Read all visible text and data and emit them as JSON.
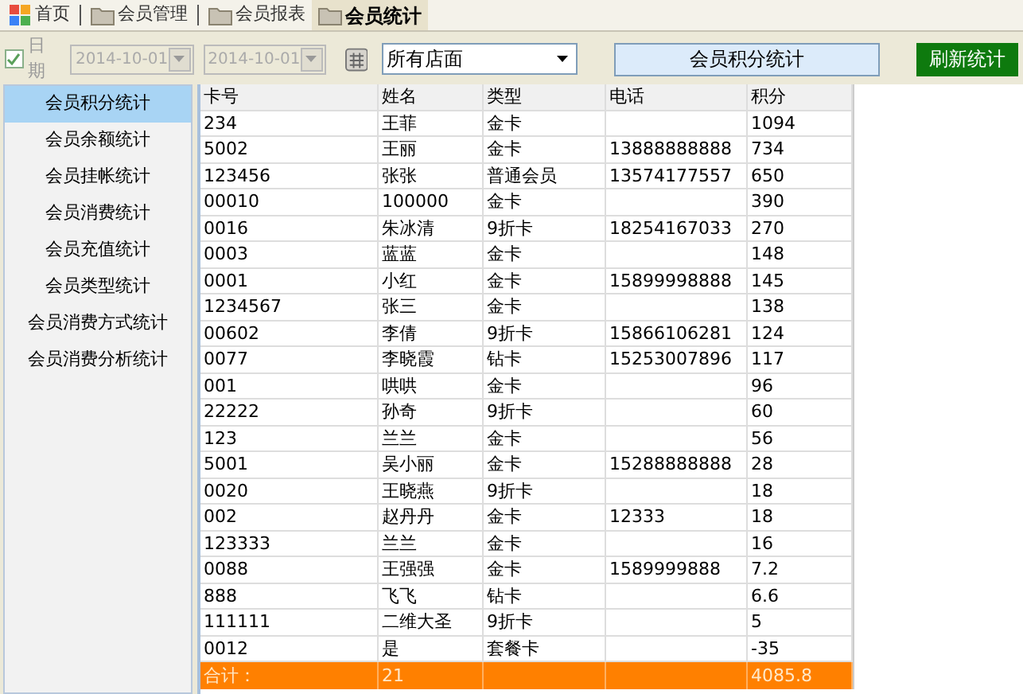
{
  "tabs": [
    {
      "label": "首页",
      "kind": "home",
      "selected": false
    },
    {
      "label": "会员管理",
      "kind": "folder",
      "selected": false
    },
    {
      "label": "会员报表",
      "kind": "folder",
      "selected": false
    },
    {
      "label": "会员统计",
      "kind": "folder",
      "selected": true
    }
  ],
  "toolbar": {
    "date_checkbox": {
      "label": "日期",
      "checked": true
    },
    "start_date": {
      "value": "2014-10-01",
      "disabled": true
    },
    "end_date": {
      "value": "2014-10-01",
      "disabled": true
    },
    "store_select": {
      "value": "所有店面"
    },
    "report_button": "会员积分统计",
    "refresh_button": "刷新统计"
  },
  "sidebar": {
    "items": [
      {
        "label": "会员积分统计",
        "selected": true
      },
      {
        "label": "会员余额统计",
        "selected": false
      },
      {
        "label": "会员挂帐统计",
        "selected": false
      },
      {
        "label": "会员消费统计",
        "selected": false
      },
      {
        "label": "会员充值统计",
        "selected": false
      },
      {
        "label": "会员类型统计",
        "selected": false
      },
      {
        "label": "会员消费方式统计",
        "selected": false
      },
      {
        "label": "会员消费分析统计",
        "selected": false
      }
    ]
  },
  "table": {
    "columns": [
      "卡号",
      "姓名",
      "类型",
      "电话",
      "积分"
    ],
    "rows": [
      [
        "234",
        "王菲",
        "金卡",
        "",
        "1094"
      ],
      [
        "5002",
        "王丽",
        "金卡",
        "13888888888",
        "734"
      ],
      [
        "123456",
        "张张",
        "普通会员",
        "13574177557",
        "650"
      ],
      [
        "00010",
        "100000",
        "金卡",
        "",
        "390"
      ],
      [
        "0016",
        "朱冰清",
        "9折卡",
        "18254167033",
        "270"
      ],
      [
        "0003",
        "蓝蓝",
        "金卡",
        "",
        "148"
      ],
      [
        "0001",
        "小红",
        "金卡",
        "15899998888",
        "145"
      ],
      [
        "1234567",
        "张三",
        "金卡",
        "",
        "138"
      ],
      [
        "00602",
        "李倩",
        "9折卡",
        "15866106281",
        "124"
      ],
      [
        "0077",
        "李晓霞",
        "钻卡",
        "15253007896",
        "117"
      ],
      [
        "001",
        "哄哄",
        "金卡",
        "",
        "96"
      ],
      [
        "22222",
        "孙奇",
        "9折卡",
        "",
        "60"
      ],
      [
        "123",
        "兰兰",
        "金卡",
        "",
        "56"
      ],
      [
        "5001",
        "吴小丽",
        "金卡",
        "15288888888",
        "28"
      ],
      [
        "0020",
        "王晓燕",
        "9折卡",
        "",
        "18"
      ],
      [
        "002",
        "赵丹丹",
        "金卡",
        "12333",
        "18"
      ],
      [
        "123333",
        "兰兰",
        "金卡",
        "",
        "16"
      ],
      [
        "0088",
        "王强强",
        "金卡",
        "1589999888",
        "7.2"
      ],
      [
        "888",
        "飞飞",
        "钻卡",
        "",
        "6.6"
      ],
      [
        "111111",
        "二维大圣",
        "9折卡",
        "",
        "5"
      ],
      [
        "0012",
        "是",
        "套餐卡",
        "",
        "-35"
      ]
    ],
    "total": {
      "label": "合计：",
      "count": "21",
      "points": "4085.8"
    }
  }
}
